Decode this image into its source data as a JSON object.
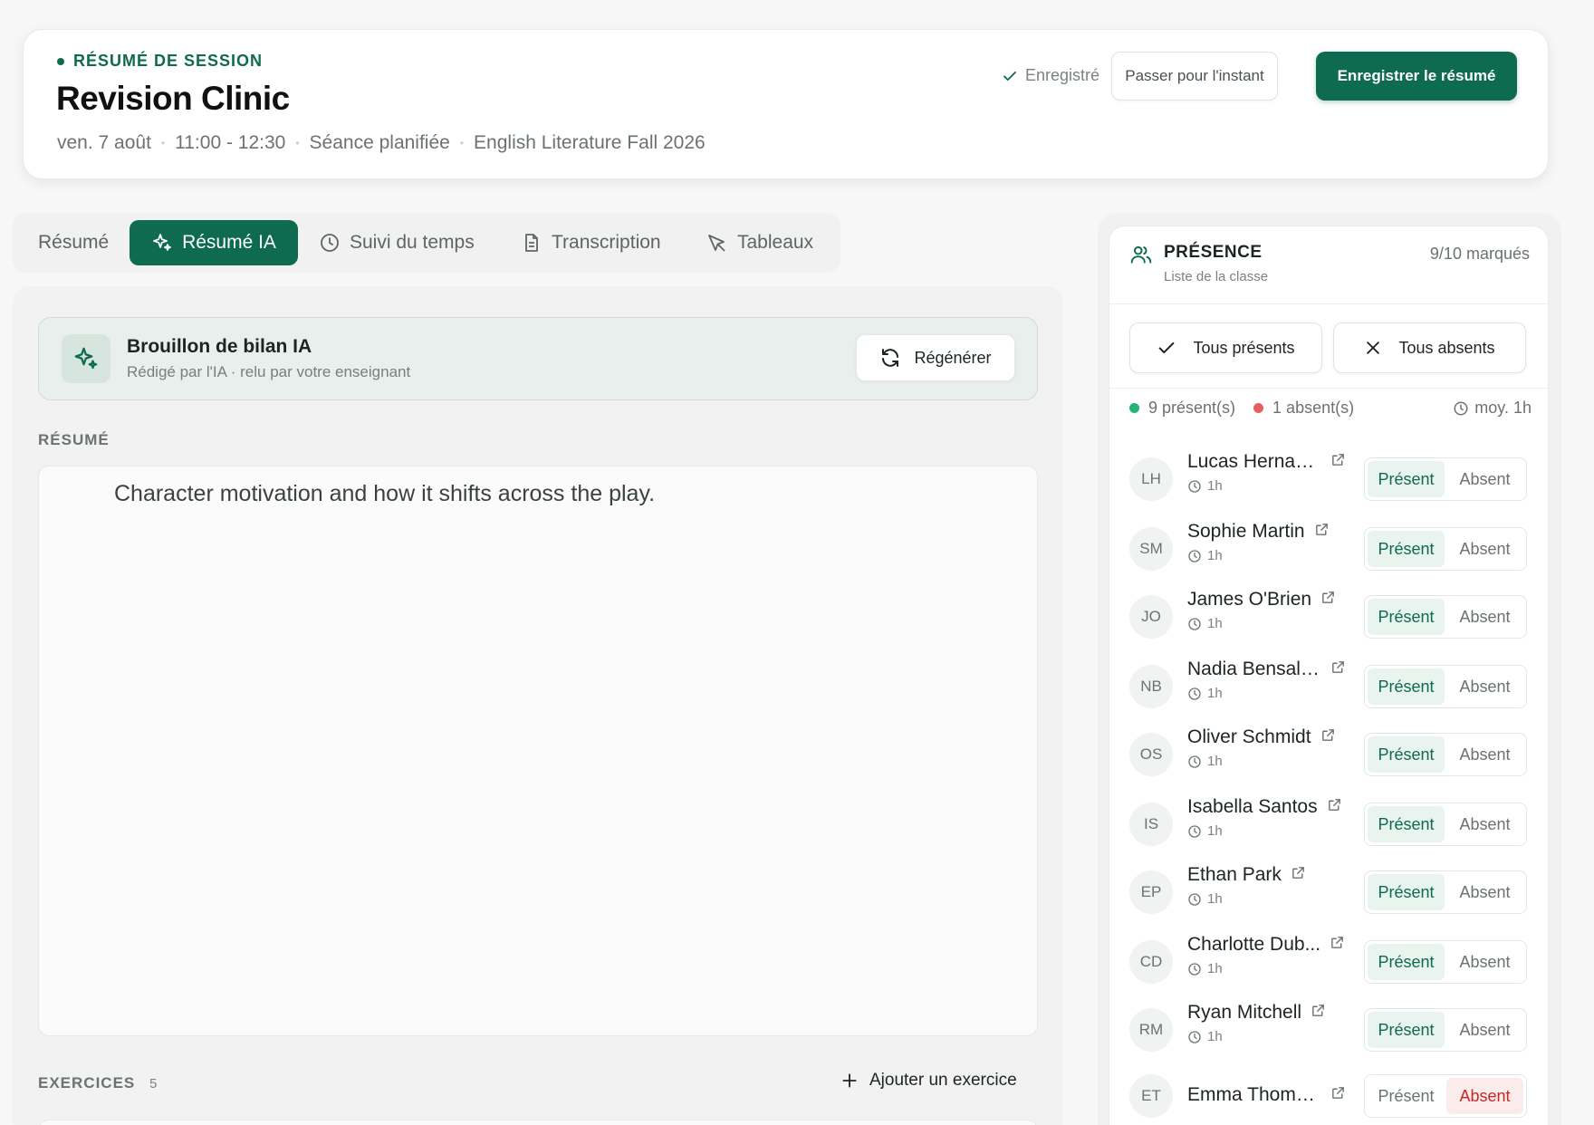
{
  "header": {
    "eyebrow": "RÉSUMÉ DE SESSION",
    "title": "Revision Clinic",
    "meta": [
      "ven. 7 août",
      "11:00 - 12:30",
      "Séance planifiée",
      "English Literature Fall 2026"
    ],
    "saved_label": "Enregistré",
    "skip_label": "Passer pour l'instant",
    "save_label": "Enregistrer le résumé"
  },
  "tabs": [
    {
      "label": "Résumé",
      "icon": "none",
      "active": false
    },
    {
      "label": "Résumé IA",
      "icon": "sparkles-icon",
      "active": true
    },
    {
      "label": "Suivi du temps",
      "icon": "clock-icon",
      "active": false
    },
    {
      "label": "Transcription",
      "icon": "document-icon",
      "active": false
    },
    {
      "label": "Tableaux",
      "icon": "pen-tool-icon",
      "active": false
    }
  ],
  "ai_draft": {
    "title": "Brouillon de bilan IA",
    "subtitle": "Rédigé par l'IA · relu par votre enseignant",
    "regen_label": "Régénérer"
  },
  "summary": {
    "label": "RÉSUMÉ",
    "text": "Character motivation and how it shifts across the play."
  },
  "exercises": {
    "label": "EXERCICES",
    "count": "5",
    "add_label": "Ajouter un exercice"
  },
  "attendance": {
    "title": "PRÉSENCE",
    "subtitle": "Liste de la classe",
    "marked": "9/10 marqués",
    "all_present": "Tous présents",
    "all_absent": "Tous absents",
    "present_count": "9 présent(s)",
    "absent_count": "1 absent(s)",
    "average": "moy. 1h",
    "present_label": "Présent",
    "absent_label": "Absent",
    "colors": {
      "accent": "#0e6b4f",
      "present_dot": "#22b573",
      "absent_dot": "#e85d5d"
    },
    "students": [
      {
        "initials": "LH",
        "name": "Lucas Hernan...",
        "duration": "1h",
        "status": "present"
      },
      {
        "initials": "SM",
        "name": "Sophie Martin",
        "duration": "1h",
        "status": "present"
      },
      {
        "initials": "JO",
        "name": "James O'Brien",
        "duration": "1h",
        "status": "present"
      },
      {
        "initials": "NB",
        "name": "Nadia Bensale...",
        "duration": "1h",
        "status": "present"
      },
      {
        "initials": "OS",
        "name": "Oliver Schmidt",
        "duration": "1h",
        "status": "present"
      },
      {
        "initials": "IS",
        "name": "Isabella Santos",
        "duration": "1h",
        "status": "present"
      },
      {
        "initials": "EP",
        "name": "Ethan Park",
        "duration": "1h",
        "status": "present"
      },
      {
        "initials": "CD",
        "name": "Charlotte Dub...",
        "duration": "1h",
        "status": "present"
      },
      {
        "initials": "RM",
        "name": "Ryan Mitchell",
        "duration": "1h",
        "status": "present"
      },
      {
        "initials": "ET",
        "name": "Emma Thomp...",
        "duration": "",
        "status": "absent"
      }
    ]
  }
}
